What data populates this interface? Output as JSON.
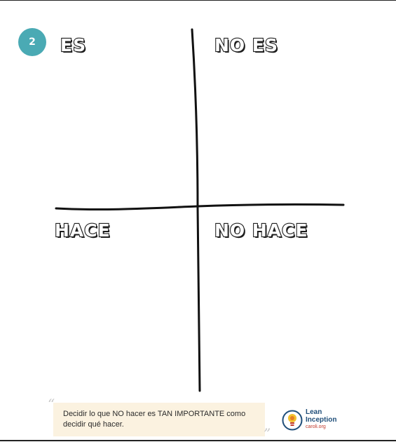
{
  "badge": {
    "number": "2",
    "color": "#4aaab4"
  },
  "quadrants": {
    "top_left": "ES",
    "top_right": "NO ES",
    "bottom_left": "HACE",
    "bottom_right": "NO HACE"
  },
  "quote": {
    "text": "Decidir lo que NO hacer es TAN IMPORTANTE como decidir qué hacer.",
    "background": "#fbf2e0"
  },
  "logo": {
    "line1": "Lean",
    "line2": "Inception",
    "line3": "caroli.org",
    "icon": "lightbulb-icon"
  },
  "colors": {
    "axis": "#111111",
    "label_outline": "#1e1e1e",
    "frame": "#2f2f2f"
  }
}
